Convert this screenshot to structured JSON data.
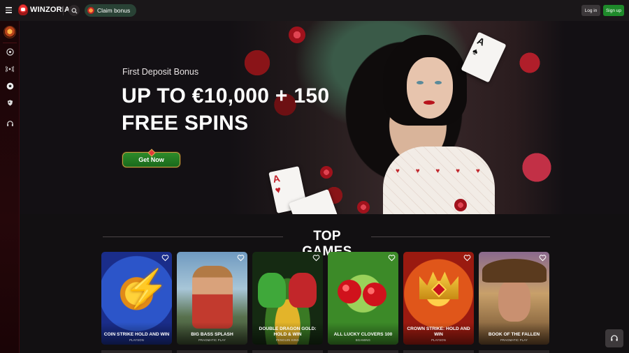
{
  "header": {
    "brand": "WINZORIA",
    "claim_bonus_label": "Claim bonus",
    "login_label": "Log in",
    "signup_label": "Sign up",
    "icons": [
      "menu-icon",
      "search-icon",
      "gift-icon"
    ]
  },
  "sidebar": {
    "items": [
      {
        "name": "casino",
        "icon": "roulette-icon"
      },
      {
        "name": "live",
        "icon": "live-icon"
      },
      {
        "name": "sports",
        "icon": "soccer-ball-icon"
      },
      {
        "name": "esports",
        "icon": "controller-icon"
      },
      {
        "name": "support",
        "icon": "headset-icon"
      }
    ]
  },
  "hero": {
    "subtitle": "First Deposit Bonus",
    "title_line1": "UP TO €10,000 + 150",
    "title_line2": "FREE SPINS",
    "cta_label": "Get Now",
    "accent_color": "#1e8a2a"
  },
  "top_games": {
    "title": "TOP GAMES",
    "games": [
      {
        "name": "COIN STRIKE HOLD AND WIN",
        "provider": "PLAYSON"
      },
      {
        "name": "BIG BASS SPLASH",
        "provider": "PRAGMATIC PLAY"
      },
      {
        "name": "DOUBLE DRAGON GOLD: HOLD & WIN",
        "provider": "PENGUIN KING"
      },
      {
        "name": "ALL LUCKY CLOVERS 100",
        "provider": "BGAMING"
      },
      {
        "name": "CROWN STRIKE: HOLD AND WIN",
        "provider": "PLAYSON"
      },
      {
        "name": "BOOK OF THE FALLEN",
        "provider": "PRAGMATIC PLAY"
      }
    ]
  },
  "support": {
    "icon": "headset-icon"
  }
}
